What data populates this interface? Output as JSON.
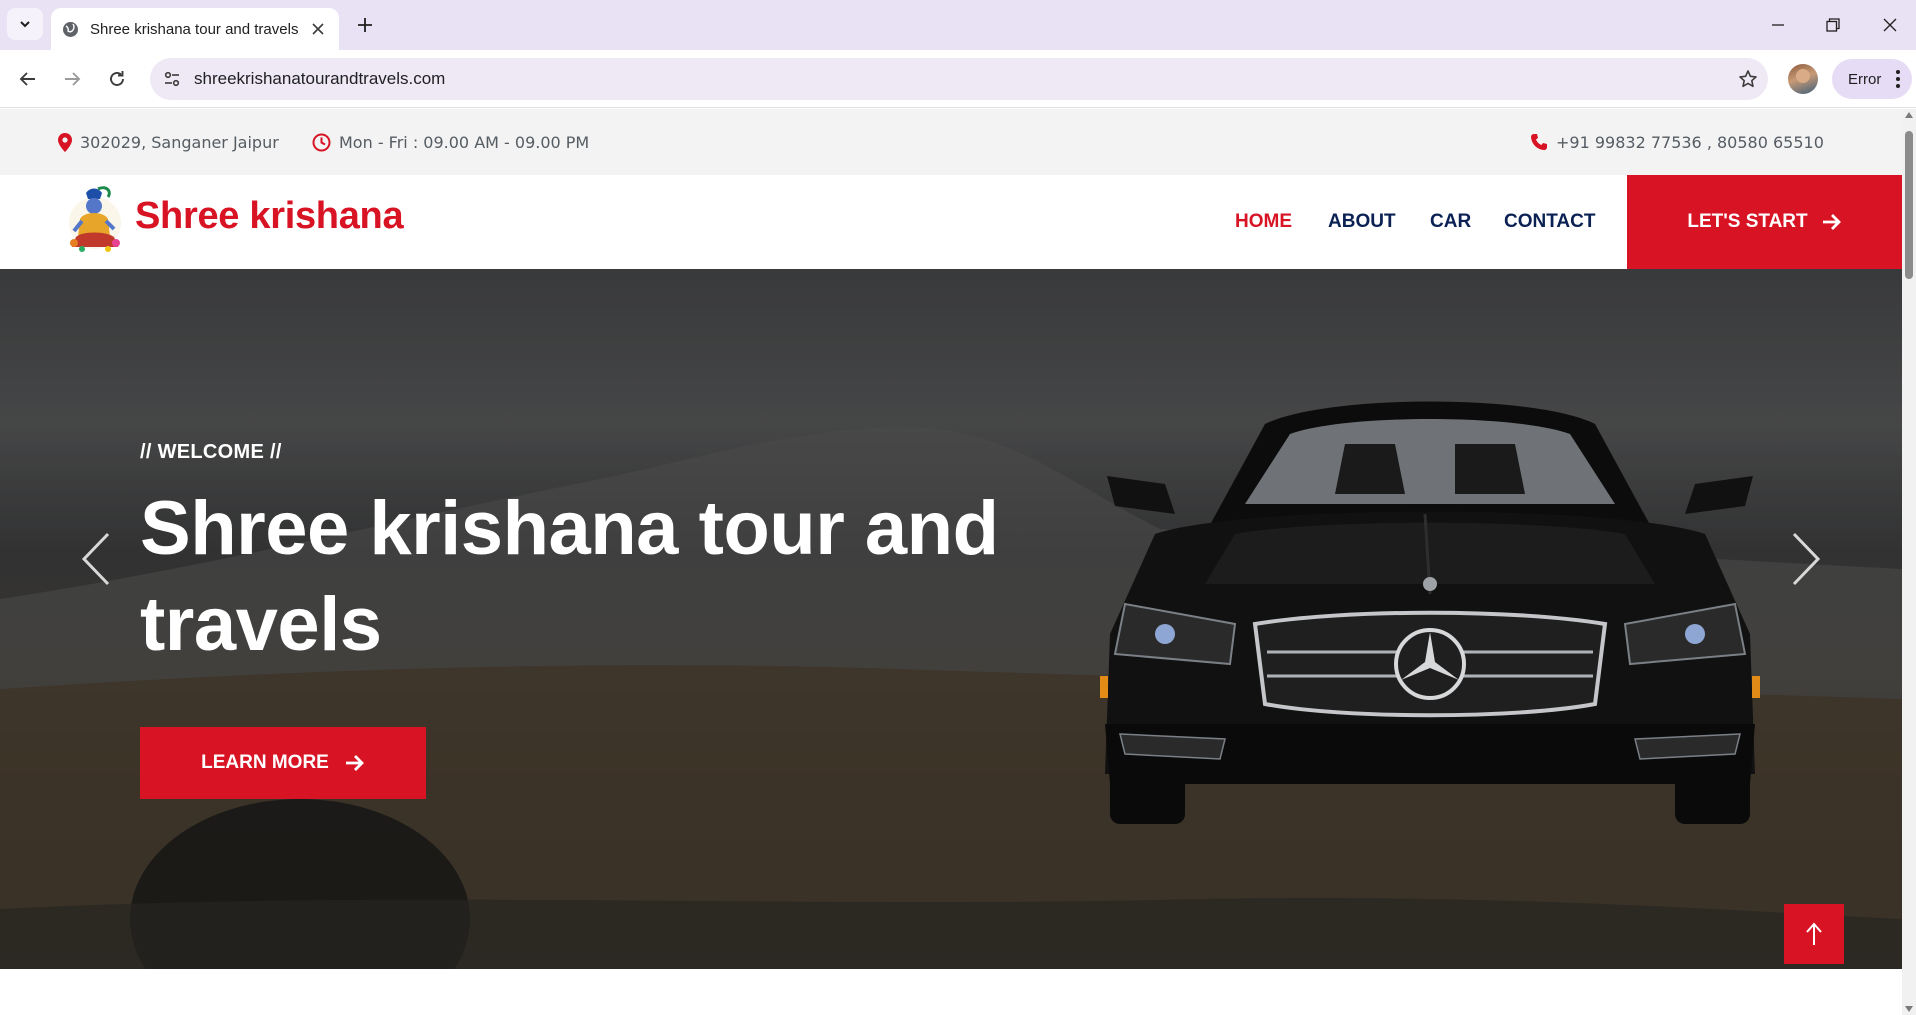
{
  "browser": {
    "tab_title": "Shree krishana tour and travels",
    "url": "shreekrishanatourandtravels.com",
    "profile_status": "Error"
  },
  "topbar": {
    "address": "302029, Sanganer Jaipur",
    "hours": "Mon - Fri : 09.00 AM - 09.00 PM",
    "phone": "+91 99832 77536 , 80580 65510"
  },
  "navbar": {
    "brand": "Shree krishana",
    "links": [
      {
        "label": "HOME",
        "active": true
      },
      {
        "label": "ABOUT",
        "active": false
      },
      {
        "label": "CAR",
        "active": false
      },
      {
        "label": "CONTACT",
        "active": false
      }
    ],
    "cta": "LET'S START"
  },
  "hero": {
    "eyebrow": "// WELCOME //",
    "title": "Shree krishana tour and travels",
    "button": "LEARN MORE"
  },
  "colors": {
    "accent": "#d81324",
    "nav_text": "#0b2154",
    "topbar_bg": "#f3f3f3"
  },
  "icons": {
    "topbar": [
      "map-marker-icon",
      "clock-icon",
      "phone-icon"
    ],
    "buttons": [
      "arrow-right-icon"
    ],
    "carousel": [
      "chevron-left-icon",
      "chevron-right-icon"
    ],
    "scroll": "arrow-up-icon"
  }
}
